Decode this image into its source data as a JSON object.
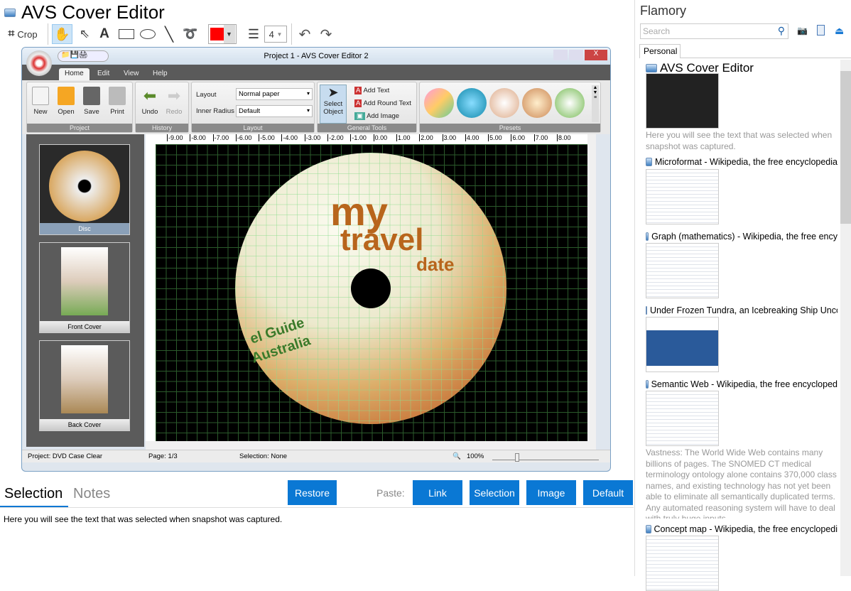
{
  "app": {
    "title": "AVS Cover Editor"
  },
  "toolbar": {
    "crop": "Crop",
    "line_width": "4",
    "color": "#ff0000"
  },
  "window": {
    "title": "Project 1 - AVS Cover Editor 2",
    "tabs": [
      "Home",
      "Edit",
      "View",
      "Help"
    ],
    "groups": {
      "project": "Project",
      "history": "History",
      "layout": "Layout",
      "general": "General Tools",
      "presets": "Presets"
    },
    "buttons": {
      "new": "New",
      "open": "Open",
      "save": "Save",
      "print": "Print",
      "undo": "Undo",
      "redo": "Redo",
      "select1": "Select",
      "select2": "Object",
      "add_text": "Add Text",
      "add_round": "Add Round Text",
      "add_image": "Add Image"
    },
    "layout_label": "Layout",
    "layout_value": "Normal paper",
    "radius_label": "Inner Radius",
    "radius_value": "Default",
    "pages": [
      "Disc",
      "Front Cover",
      "Back Cover"
    ],
    "ruler_top": [
      "-9.00",
      "-8.00",
      "-7.00",
      "-6.00",
      "-5.00",
      "-4.00",
      "-3.00",
      "-2.00",
      "-1.00",
      "0.00",
      "1.00",
      "2.00",
      "3.00",
      "4.00",
      "5.00",
      "6.00",
      "7.00",
      "8.00"
    ],
    "disc": {
      "t1": "my",
      "t2": "travel",
      "t3": "date",
      "t4": "el Guide",
      "t5": "Australia"
    },
    "status": {
      "project": "Project: DVD Case Clear",
      "page": "Page: 1/3",
      "selection": "Selection: None",
      "zoom": "100%"
    }
  },
  "bottom": {
    "tab_selection": "Selection",
    "tab_notes": "Notes",
    "restore": "Restore",
    "paste": "Paste:",
    "link": "Link",
    "selection": "Selection",
    "image": "Image",
    "default": "Default",
    "text": "Here you will see the text that was selected when snapshot was captured."
  },
  "flamory": {
    "title": "Flamory",
    "search_placeholder": "Search",
    "tab": "Personal",
    "items": [
      {
        "title": "AVS Cover Editor",
        "desc": "Here you will see the text that was selected when snapshot was captured."
      },
      {
        "title": "Microformat - Wikipedia, the free encyclopedia"
      },
      {
        "title": "Graph (mathematics) - Wikipedia, the free ency"
      },
      {
        "title": "Under Frozen Tundra, an Icebreaking Ship Unco"
      },
      {
        "title": "Semantic Web - Wikipedia, the free encycloped",
        "desc": "Vastness: The World Wide Web contains many billions of pages. The SNOMED CT medical terminology ontology alone contains 370,000 class names, and existing technology has not yet been able to eliminate all semantically duplicated terms. Any automated reasoning system will have to deal with truly huge inputs."
      },
      {
        "title": "Concept map - Wikipedia, the free encyclopedi"
      }
    ]
  }
}
